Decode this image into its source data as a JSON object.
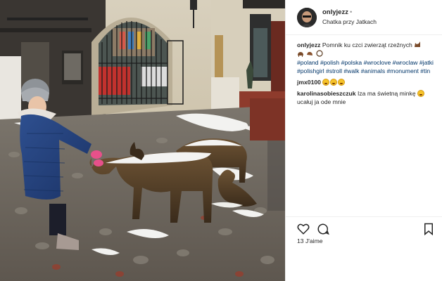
{
  "post": {
    "username": "onlyjezz",
    "follow_dot": "•",
    "location": "Chatka przy Jatkach"
  },
  "caption": {
    "user": "onlyjezz",
    "text": "Pomnik ku czci zwierząt rzeźnych",
    "hashtags": "#poland #polish #polska #wroclove #wroclaw #jatki #polishgirl #stroll #walk #animals #monument #tin"
  },
  "comments": [
    {
      "user": "jmx0100",
      "text": ""
    },
    {
      "user": "karolinasobieszczuk",
      "text": "Iza ma świetną minkę",
      "text2": "ucałuj ja ode mnie"
    }
  ],
  "likes": "13 J'aime",
  "icons": [
    "heart-icon",
    "comment-icon",
    "bookmark-icon",
    "cat-emoji",
    "goat-emoji",
    "laugh-emoji",
    "smile-emoji"
  ],
  "colors": {
    "hashtag": "#003569",
    "text": "#262626",
    "border": "#efefef"
  }
}
